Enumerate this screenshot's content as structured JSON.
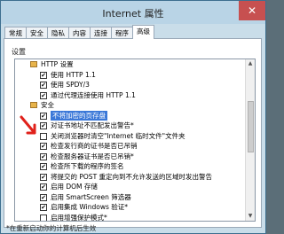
{
  "window": {
    "title": "Internet 属性",
    "close_glyph": "✕"
  },
  "tabs": [
    {
      "label": "常规"
    },
    {
      "label": "安全"
    },
    {
      "label": "隐私"
    },
    {
      "label": "内容"
    },
    {
      "label": "连接"
    },
    {
      "label": "程序"
    },
    {
      "label": "高级",
      "active": true
    }
  ],
  "settings": {
    "section_label": "设置",
    "items": [
      {
        "label": "HTTP 设置",
        "checked": false,
        "group": true
      },
      {
        "label": "使用 HTTP 1.1",
        "checked": true
      },
      {
        "label": "使用 SPDY/3",
        "checked": true
      },
      {
        "label": "通过代理连接使用 HTTP 1.1",
        "checked": true
      },
      {
        "label": "安全",
        "checked": false,
        "group": true
      },
      {
        "label": "不将加密的页存盘",
        "checked": true,
        "highlight": true
      },
      {
        "label": "对证书地址不匹配发出警告*",
        "checked": true
      },
      {
        "label": "关闭浏览器时清空\"Internet 临时文件\"文件夹",
        "checked": false
      },
      {
        "label": "检查发行商的证书是否已吊销",
        "checked": true
      },
      {
        "label": "检查服务器证书是否已吊销*",
        "checked": true
      },
      {
        "label": "检查所下载的程序的签名",
        "checked": true
      },
      {
        "label": "将提交的 POST 重定向到不允许发送的区域时发出警告",
        "checked": true
      },
      {
        "label": "启用 DOM 存储",
        "checked": true
      },
      {
        "label": "启用 SmartScreen 筛选器",
        "checked": true
      },
      {
        "label": "启用集成 Windows 验证*",
        "checked": true
      },
      {
        "label": "启用增强保护模式*",
        "checked": false
      }
    ]
  },
  "footnote": "*在重新启动你的计算机后生效",
  "scroll_position": 0.35,
  "colors": {
    "highlight": "#3b78d8",
    "close": "#c75050",
    "arrow": "#e0211b"
  }
}
